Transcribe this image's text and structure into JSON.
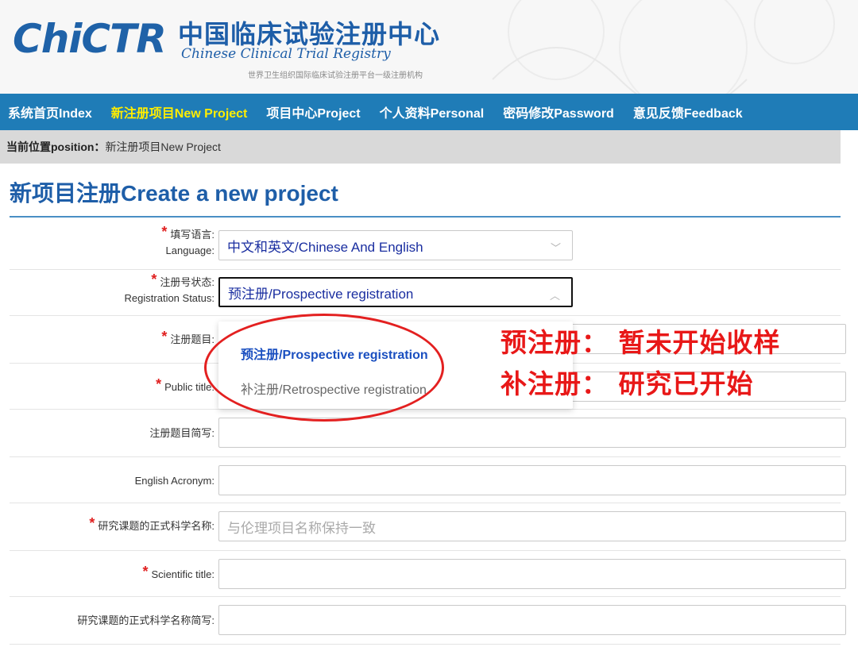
{
  "header": {
    "logo_text": "ChiCTR",
    "title_cn": "中国临床试验注册中心",
    "title_en": "Chinese Clinical Trial Registry",
    "note": "世界卫生组织国际临床试验注册平台一级注册机构"
  },
  "nav": {
    "items": [
      {
        "label": "系统首页Index"
      },
      {
        "label": "新注册项目New Project"
      },
      {
        "label": "项目中心Project"
      },
      {
        "label": "个人资料Personal"
      },
      {
        "label": "密码修改Password"
      },
      {
        "label": "意见反馈Feedback"
      }
    ]
  },
  "breadcrumb": {
    "prefix": "当前位置position：",
    "current": "新注册项目New Project"
  },
  "page": {
    "title": "新项目注册Create a new project"
  },
  "form": {
    "language": {
      "label_cn": "填写语言:",
      "label_en": "Language:",
      "value": "中文和英文/Chinese And English"
    },
    "status": {
      "label_cn": "注册号状态:",
      "label_en": "Registration Status:",
      "value": "预注册/Prospective registration"
    },
    "title_cn": {
      "label": "注册题目:"
    },
    "public_title": {
      "label": "Public title:"
    },
    "short_cn": {
      "label": "注册题目简写:"
    },
    "acronym": {
      "label": "English Acronym:"
    },
    "sci_name_cn": {
      "label": "研究课题的正式科学名称:",
      "placeholder": "与伦理项目名称保持一致"
    },
    "sci_title": {
      "label": "Scientific title:"
    },
    "sci_short_cn": {
      "label": "研究课题的正式科学名称简写:"
    }
  },
  "dropdown": {
    "options": [
      {
        "label": "预注册/Prospective registration",
        "selected": true
      },
      {
        "label": "补注册/Retrospective registration",
        "selected": false
      }
    ]
  },
  "annotation": {
    "line1": "预注册： 暂未开始收样",
    "line2": "补注册： 研究已开始",
    "color": "#e81818"
  },
  "colors": {
    "nav_bg": "#1f7cb7",
    "nav_active": "#ffed00",
    "brand_blue": "#1e5ea8"
  }
}
